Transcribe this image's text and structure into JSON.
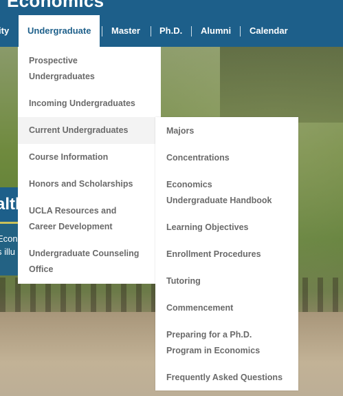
{
  "header": {
    "site_title": "Economics",
    "nav": [
      {
        "label": "ity"
      },
      {
        "label": "Undergraduate"
      },
      {
        "label": "Master"
      },
      {
        "label": "Ph.D."
      },
      {
        "label": "Alumni"
      },
      {
        "label": "Calendar"
      }
    ]
  },
  "background_teaser": {
    "heading_fragment": "alth",
    "line1": "Econ",
    "line2": "s illu"
  },
  "dropdown": {
    "items": [
      {
        "label": "Prospective Undergraduates"
      },
      {
        "label": "Incoming Undergraduates"
      },
      {
        "label": "Current Undergraduates"
      },
      {
        "label": "Course Information"
      },
      {
        "label": "Honors and Scholarships"
      },
      {
        "label": "UCLA Resources and Career Development"
      },
      {
        "label": "Undergraduate Counseling Office"
      }
    ]
  },
  "submenu": {
    "items": [
      {
        "label": "Majors"
      },
      {
        "label": "Concentrations"
      },
      {
        "label": "Economics Undergraduate Handbook"
      },
      {
        "label": "Learning Objectives"
      },
      {
        "label": "Enrollment Procedures"
      },
      {
        "label": "Tutoring"
      },
      {
        "label": "Commencement"
      },
      {
        "label": "Preparing for a Ph.D. Program in Economics"
      },
      {
        "label": "Frequently Asked Questions"
      }
    ]
  },
  "colors": {
    "header_blue": "#1d5f8a",
    "menu_text": "#6a6a6a",
    "menu_bg": "#ffffff",
    "active_item_bg": "#f3f3f3"
  }
}
